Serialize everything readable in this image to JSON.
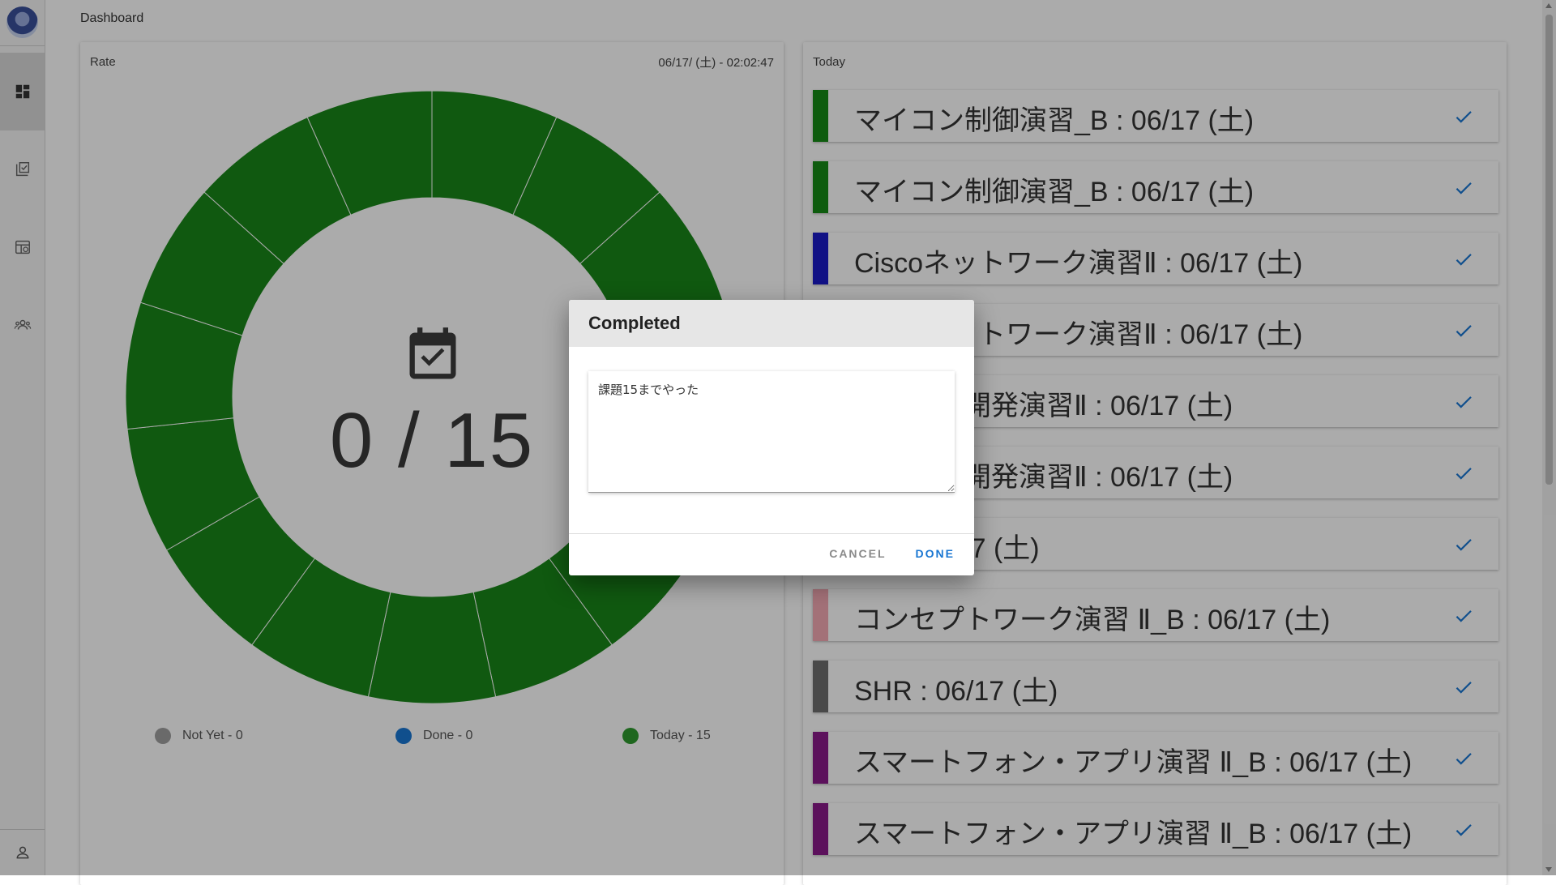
{
  "breadcrumb": "Dashboard",
  "sidebar": {
    "items": [
      {
        "icon": "dashboard-icon",
        "active": true
      },
      {
        "icon": "task-checklist-icon",
        "active": false
      },
      {
        "icon": "timetable-icon",
        "active": false
      },
      {
        "icon": "group-icon",
        "active": false
      }
    ],
    "bottom_icon": "user-icon"
  },
  "rate": {
    "title": "Rate",
    "timestamp": "06/17/ (土) - 02:02:47",
    "count": "0 / 15",
    "legend": [
      {
        "label": "Not Yet - 0",
        "color": "#9e9e9e"
      },
      {
        "label": "Done - 0",
        "color": "#1976d2"
      },
      {
        "label": "Today - 15",
        "color": "#2e9a2e"
      }
    ]
  },
  "chart_data": {
    "type": "pie",
    "categories": [
      "Not Yet",
      "Done",
      "Today"
    ],
    "values": [
      0,
      0,
      15
    ],
    "colors": [
      "#9e9e9e",
      "#1976d2",
      "#188518"
    ]
  },
  "today": {
    "title": "Today",
    "courses": [
      {
        "name": "マイコン制御演習_B : 06/17 (土)",
        "color": "#168a16"
      },
      {
        "name": "マイコン制御演習_B : 06/17 (土)",
        "color": "#168a16"
      },
      {
        "name": "Ciscoネットワーク演習Ⅱ : 06/17 (土)",
        "color": "#1a1ac6"
      },
      {
        "name": "Ciscoネットワーク演習Ⅱ : 06/17 (土)",
        "color": "#1a1ac6"
      },
      {
        "name": "システム開発演習Ⅱ : 06/17 (土)",
        "color": "#1a1ac6"
      },
      {
        "name": "システム開発演習Ⅱ : 06/17 (土)",
        "color": "#1a1ac6"
      },
      {
        "name": "HR : 06/17 (土)",
        "color": "#555555"
      },
      {
        "name": "コンセプトワーク演習 Ⅱ_B : 06/17 (土)",
        "color": "#f4a9b4"
      },
      {
        "name": "SHR : 06/17 (土)",
        "color": "#6e6e6e"
      },
      {
        "name": "スマートフォン・アプリ演習 Ⅱ_B : 06/17 (土)",
        "color": "#8a1a8a"
      },
      {
        "name": "スマートフォン・アプリ演習 Ⅱ_B : 06/17 (土)",
        "color": "#8a1a8a"
      }
    ]
  },
  "dialog": {
    "title": "Completed",
    "text": "課題15までやった",
    "cancel_label": "CANCEL",
    "done_label": "DONE"
  }
}
